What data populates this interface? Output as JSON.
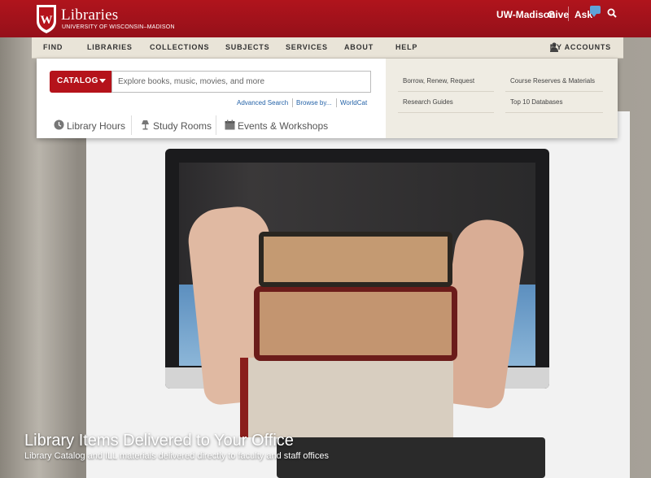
{
  "header": {
    "brand_title": "Libraries",
    "brand_subtitle": "UNIVERSITY OF WISCONSIN–MADISON",
    "links": {
      "uw": "UW-Madison",
      "give": "Give",
      "ask": "Ask"
    }
  },
  "nav": {
    "items": [
      "FIND",
      "LIBRARIES",
      "COLLECTIONS",
      "SUBJECTS",
      "SERVICES",
      "ABOUT",
      "HELP"
    ],
    "accounts": "MY ACCOUNTS"
  },
  "search": {
    "scope": "CATALOG",
    "placeholder": "Explore books, music, movies, and more",
    "links": [
      "Advanced Search",
      "Browse by...",
      "WorldCat"
    ]
  },
  "tools": [
    "Library Hours",
    "Study Rooms",
    "Events & Workshops"
  ],
  "quick_links": {
    "left": [
      "Borrow, Renew, Request",
      "Research Guides"
    ],
    "right": [
      "Course Reserves & Materials",
      "Top 10 Databases"
    ]
  },
  "hero": {
    "title": "Library Items Delivered to Your Office",
    "subtitle": "Library Catalog and ILL materials delivered directly to faculty and staff offices"
  },
  "colors": {
    "brand_red": "#a3121a",
    "nav_bg": "#e9e4d8",
    "link_blue": "#2563a8"
  }
}
